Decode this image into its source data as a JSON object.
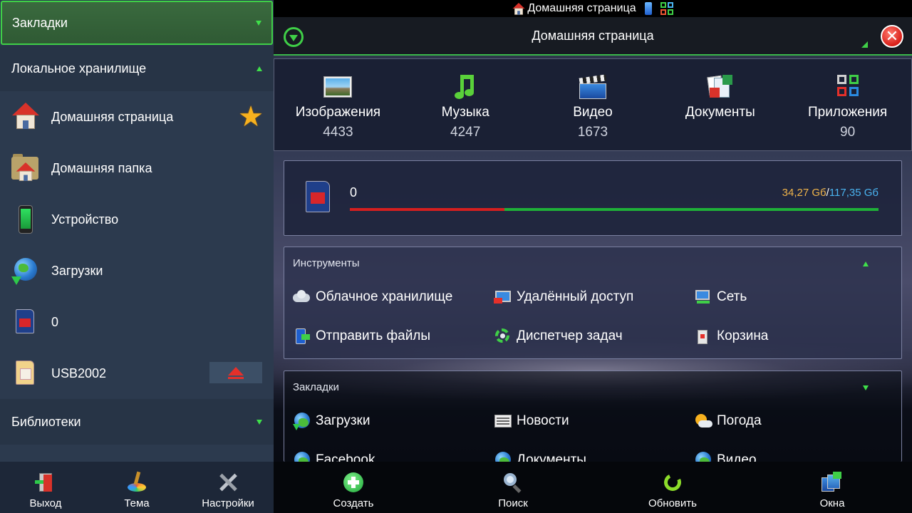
{
  "statusbar": {
    "title": "Домашняя страница"
  },
  "sidebar": {
    "header": "Закладки",
    "local_section": "Локальное хранилище",
    "items": [
      {
        "label": "Домашняя страница",
        "icon": "home-icon",
        "starred": true
      },
      {
        "label": "Домашняя папка",
        "icon": "home-folder-icon"
      },
      {
        "label": "Устройство",
        "icon": "phone-icon"
      },
      {
        "label": "Загрузки",
        "icon": "globe-download-icon"
      },
      {
        "label": "0",
        "icon": "sd-card-icon"
      },
      {
        "label": "USB2002",
        "icon": "memory-card-icon",
        "ejectable": true
      }
    ],
    "libraries_section": "Библиотеки",
    "bottom": [
      {
        "label": "Выход",
        "icon": "exit-icon"
      },
      {
        "label": "Тема",
        "icon": "theme-icon"
      },
      {
        "label": "Настройки",
        "icon": "settings-icon"
      }
    ]
  },
  "titlebar": {
    "title": "Домашняя страница"
  },
  "categories": [
    {
      "label": "Изображения",
      "count": "4433",
      "icon": "pictures-icon"
    },
    {
      "label": "Музыка",
      "count": "4247",
      "icon": "music-icon"
    },
    {
      "label": "Видео",
      "count": "1673",
      "icon": "video-icon"
    },
    {
      "label": "Документы",
      "count": "",
      "icon": "documents-icon"
    },
    {
      "label": "Приложения",
      "count": "90",
      "icon": "apps-icon"
    }
  ],
  "storage": {
    "name": "0",
    "used": "34,27 Gб",
    "separator": "/",
    "total": "117,35 Gб",
    "used_fraction": 0.292,
    "colors": {
      "used": "#d61f1f",
      "free": "#1fb038"
    }
  },
  "tools": {
    "title": "Инструменты",
    "items": [
      {
        "label": "Облачное хранилище",
        "icon": "cloud-icon"
      },
      {
        "label": "Удалённый доступ",
        "icon": "remote-access-icon"
      },
      {
        "label": "Сеть",
        "icon": "network-icon"
      },
      {
        "label": "Отправить файлы",
        "icon": "send-files-icon"
      },
      {
        "label": "Диспетчер задач",
        "icon": "task-manager-icon"
      },
      {
        "label": "Корзина",
        "icon": "trash-icon"
      }
    ]
  },
  "bookmarks": {
    "title": "Закладки",
    "items": [
      {
        "label": "Загрузки",
        "icon": "globe-download-icon"
      },
      {
        "label": "Новости",
        "icon": "news-icon"
      },
      {
        "label": "Погода",
        "icon": "weather-icon"
      },
      {
        "label": "Facebook",
        "icon": "globe-icon"
      },
      {
        "label": "Документы",
        "icon": "globe-icon"
      },
      {
        "label": "Видео",
        "icon": "globe-icon"
      }
    ]
  },
  "bottombar": [
    {
      "label": "Создать",
      "icon": "add-icon"
    },
    {
      "label": "Поиск",
      "icon": "search-icon"
    },
    {
      "label": "Обновить",
      "icon": "refresh-icon"
    },
    {
      "label": "Окна",
      "icon": "windows-icon"
    }
  ],
  "accent_color": "#3fcf47"
}
